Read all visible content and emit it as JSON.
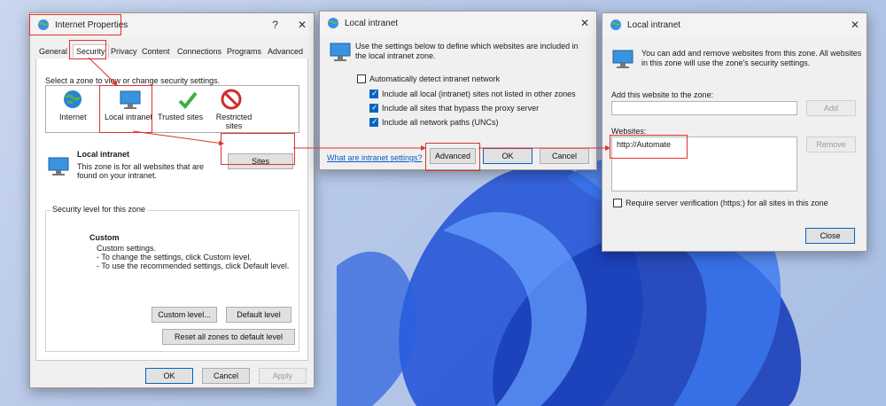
{
  "internet_properties": {
    "title": "Internet Properties",
    "help": "?",
    "close": "✕",
    "tabs": [
      "General",
      "Security",
      "Privacy",
      "Content",
      "Connections",
      "Programs",
      "Advanced"
    ],
    "select_zone_text": "Select a zone to view or change security settings.",
    "zones": [
      {
        "label": "Internet",
        "icon": "globe-icon"
      },
      {
        "label": "Local intranet",
        "icon": "monitor-icon"
      },
      {
        "label": "Trusted sites",
        "icon": "checkmark-icon"
      },
      {
        "label": "Restricted sites",
        "icon": "forbidden-icon"
      }
    ],
    "zone_title": "Local intranet",
    "zone_desc": "This zone is for all websites that are found on your intranet.",
    "sites_button": "Sites",
    "security_level_label": "Security level for this zone",
    "custom_title": "Custom",
    "custom_lines": [
      "Custom settings.",
      "- To change the settings, click Custom level.",
      "- To use the recommended settings, click Default level."
    ],
    "custom_level_button": "Custom level...",
    "default_level_button": "Default level",
    "reset_button": "Reset all zones to default level",
    "ok": "OK",
    "cancel": "Cancel",
    "apply": "Apply"
  },
  "local_intranet_1": {
    "title": "Local intranet",
    "close": "✕",
    "desc": "Use the settings below to define which websites are included in the local intranet zone.",
    "auto_detect": "Automatically detect intranet network",
    "options": [
      "Include all local (intranet) sites not listed in other zones",
      "Include all sites that bypass the proxy server",
      "Include all network paths (UNCs)"
    ],
    "help_link": "What are intranet settings?",
    "advanced": "Advanced",
    "ok": "OK",
    "cancel": "Cancel"
  },
  "local_intranet_2": {
    "title": "Local intranet",
    "close": "✕",
    "desc": "You can add and remove websites from this zone. All websites in this zone will use the zone's security settings.",
    "add_label": "Add this website to the zone:",
    "add_value": "",
    "add_button": "Add",
    "websites_label": "Websites:",
    "websites": [
      "http://Automate"
    ],
    "remove_button": "Remove",
    "require_https": "Require server verification (https:) for all sites in this zone",
    "close_button": "Close"
  },
  "colors": {
    "annotation": "#e0322d",
    "accent": "#0067c0"
  }
}
